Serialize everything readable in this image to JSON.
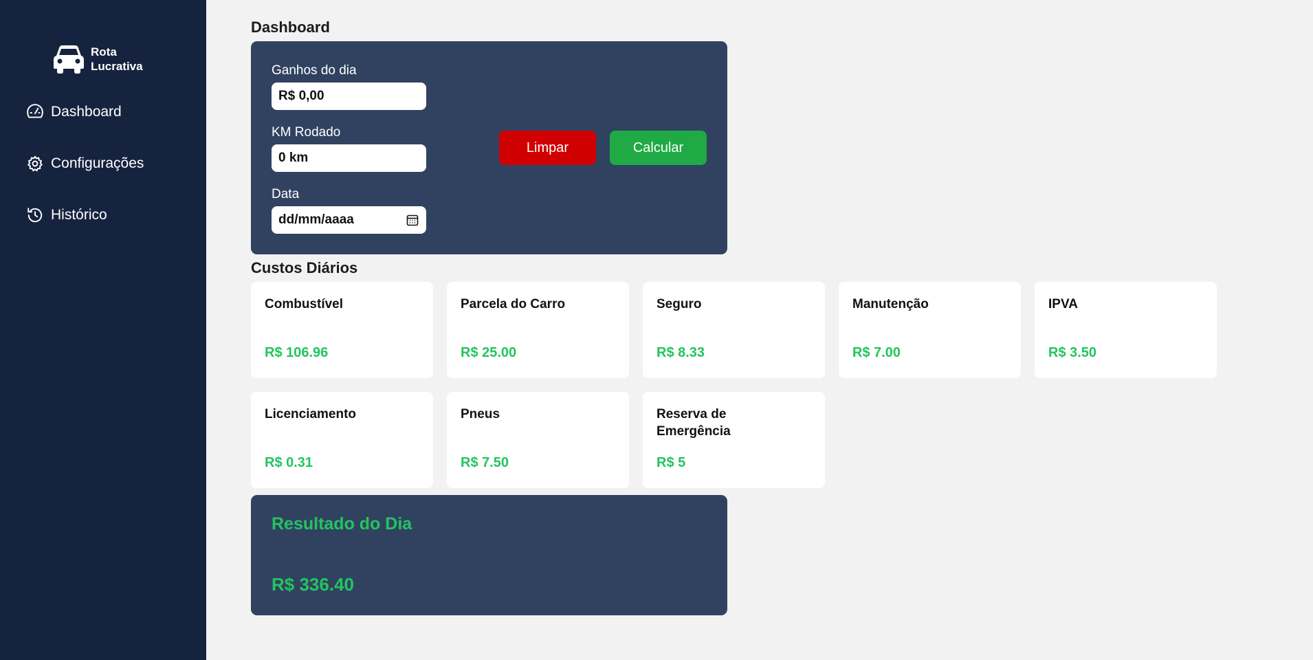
{
  "app": {
    "name_line1": "Rota",
    "name_line2": "Lucrativa"
  },
  "sidebar": {
    "items": [
      {
        "label": "Dashboard",
        "icon": "gauge-icon"
      },
      {
        "label": "Configurações",
        "icon": "gear-icon"
      },
      {
        "label": "Histórico",
        "icon": "history-icon"
      }
    ]
  },
  "dashboard": {
    "title": "Dashboard",
    "earnings_label": "Ganhos do dia",
    "earnings_value": "R$ 0,00",
    "km_label": "KM Rodado",
    "km_value": "0 km",
    "date_label": "Data",
    "date_value": "dd/mm/aaaa",
    "clear_button": "Limpar",
    "calculate_button": "Calcular"
  },
  "costs": {
    "title": "Custos Diários",
    "items": [
      {
        "label": "Combustível",
        "value": "R$ 106.96"
      },
      {
        "label": "Parcela do Carro",
        "value": "R$ 25.00"
      },
      {
        "label": "Seguro",
        "value": "R$ 8.33"
      },
      {
        "label": "Manutenção",
        "value": "R$ 7.00"
      },
      {
        "label": "IPVA",
        "value": "R$ 3.50"
      },
      {
        "label": "Licenciamento",
        "value": "R$ 0.31"
      },
      {
        "label": "Pneus",
        "value": "R$ 7.50"
      },
      {
        "label": "Reserva de Emergência",
        "value": "R$ 5"
      }
    ]
  },
  "result": {
    "title": "Resultado do Dia",
    "value": "R$ 336.40"
  },
  "colors": {
    "sidebar_bg": "#16233f",
    "panel_bg": "#314261",
    "clear_button": "#d10000",
    "calculate_button": "#1faa45",
    "positive_value": "#22c55e"
  }
}
